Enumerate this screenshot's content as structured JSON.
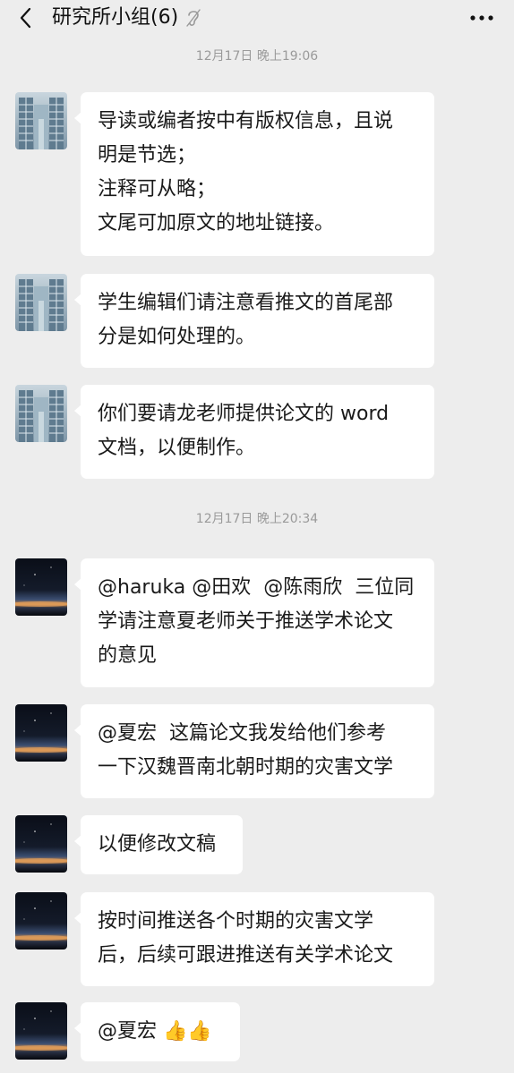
{
  "header": {
    "title": "研究所小组(6)",
    "back_icon": "chevron-left-icon",
    "mute_icon": "mute-ear-icon",
    "more_icon": "more-dots-icon"
  },
  "timestamps": [
    "12月17日 晚上19:06",
    "12月17日 晚上20:34"
  ],
  "messages": [
    {
      "text": "导读或编者按中有版权信息，且说\n明是节选；\n注释可从略；\n文尾可加原文的地址链接。"
    },
    {
      "text": "学生编辑们请注意看推文的首尾部\n分是如何处理的。"
    },
    {
      "text": "你们要请龙老师提供论文的 word\n文档，以便制作。"
    },
    {
      "text": "@haruka @田欢  @陈雨欣  三位同\n学请注意夏老师关于推送学术论文\n的意见"
    },
    {
      "text": "@夏宏  这篇论文我发给他们参考\n一下汉魏晋南北朝时期的灾害文学"
    },
    {
      "text": "以便修改文稿"
    },
    {
      "text": "按时间推送各个时期的灾害文学\n后，后续可跟进推送有关学术论文"
    },
    {
      "text": "@夏宏 ",
      "emoji": "👍👍",
      "emoji_icon": "thumbs-up-icon"
    }
  ],
  "avatars": [
    "building-avatar",
    "night-sky-avatar"
  ],
  "colors": {
    "background": "#ededed",
    "bubble": "#ffffff",
    "timestamp": "#9a9a9a"
  }
}
